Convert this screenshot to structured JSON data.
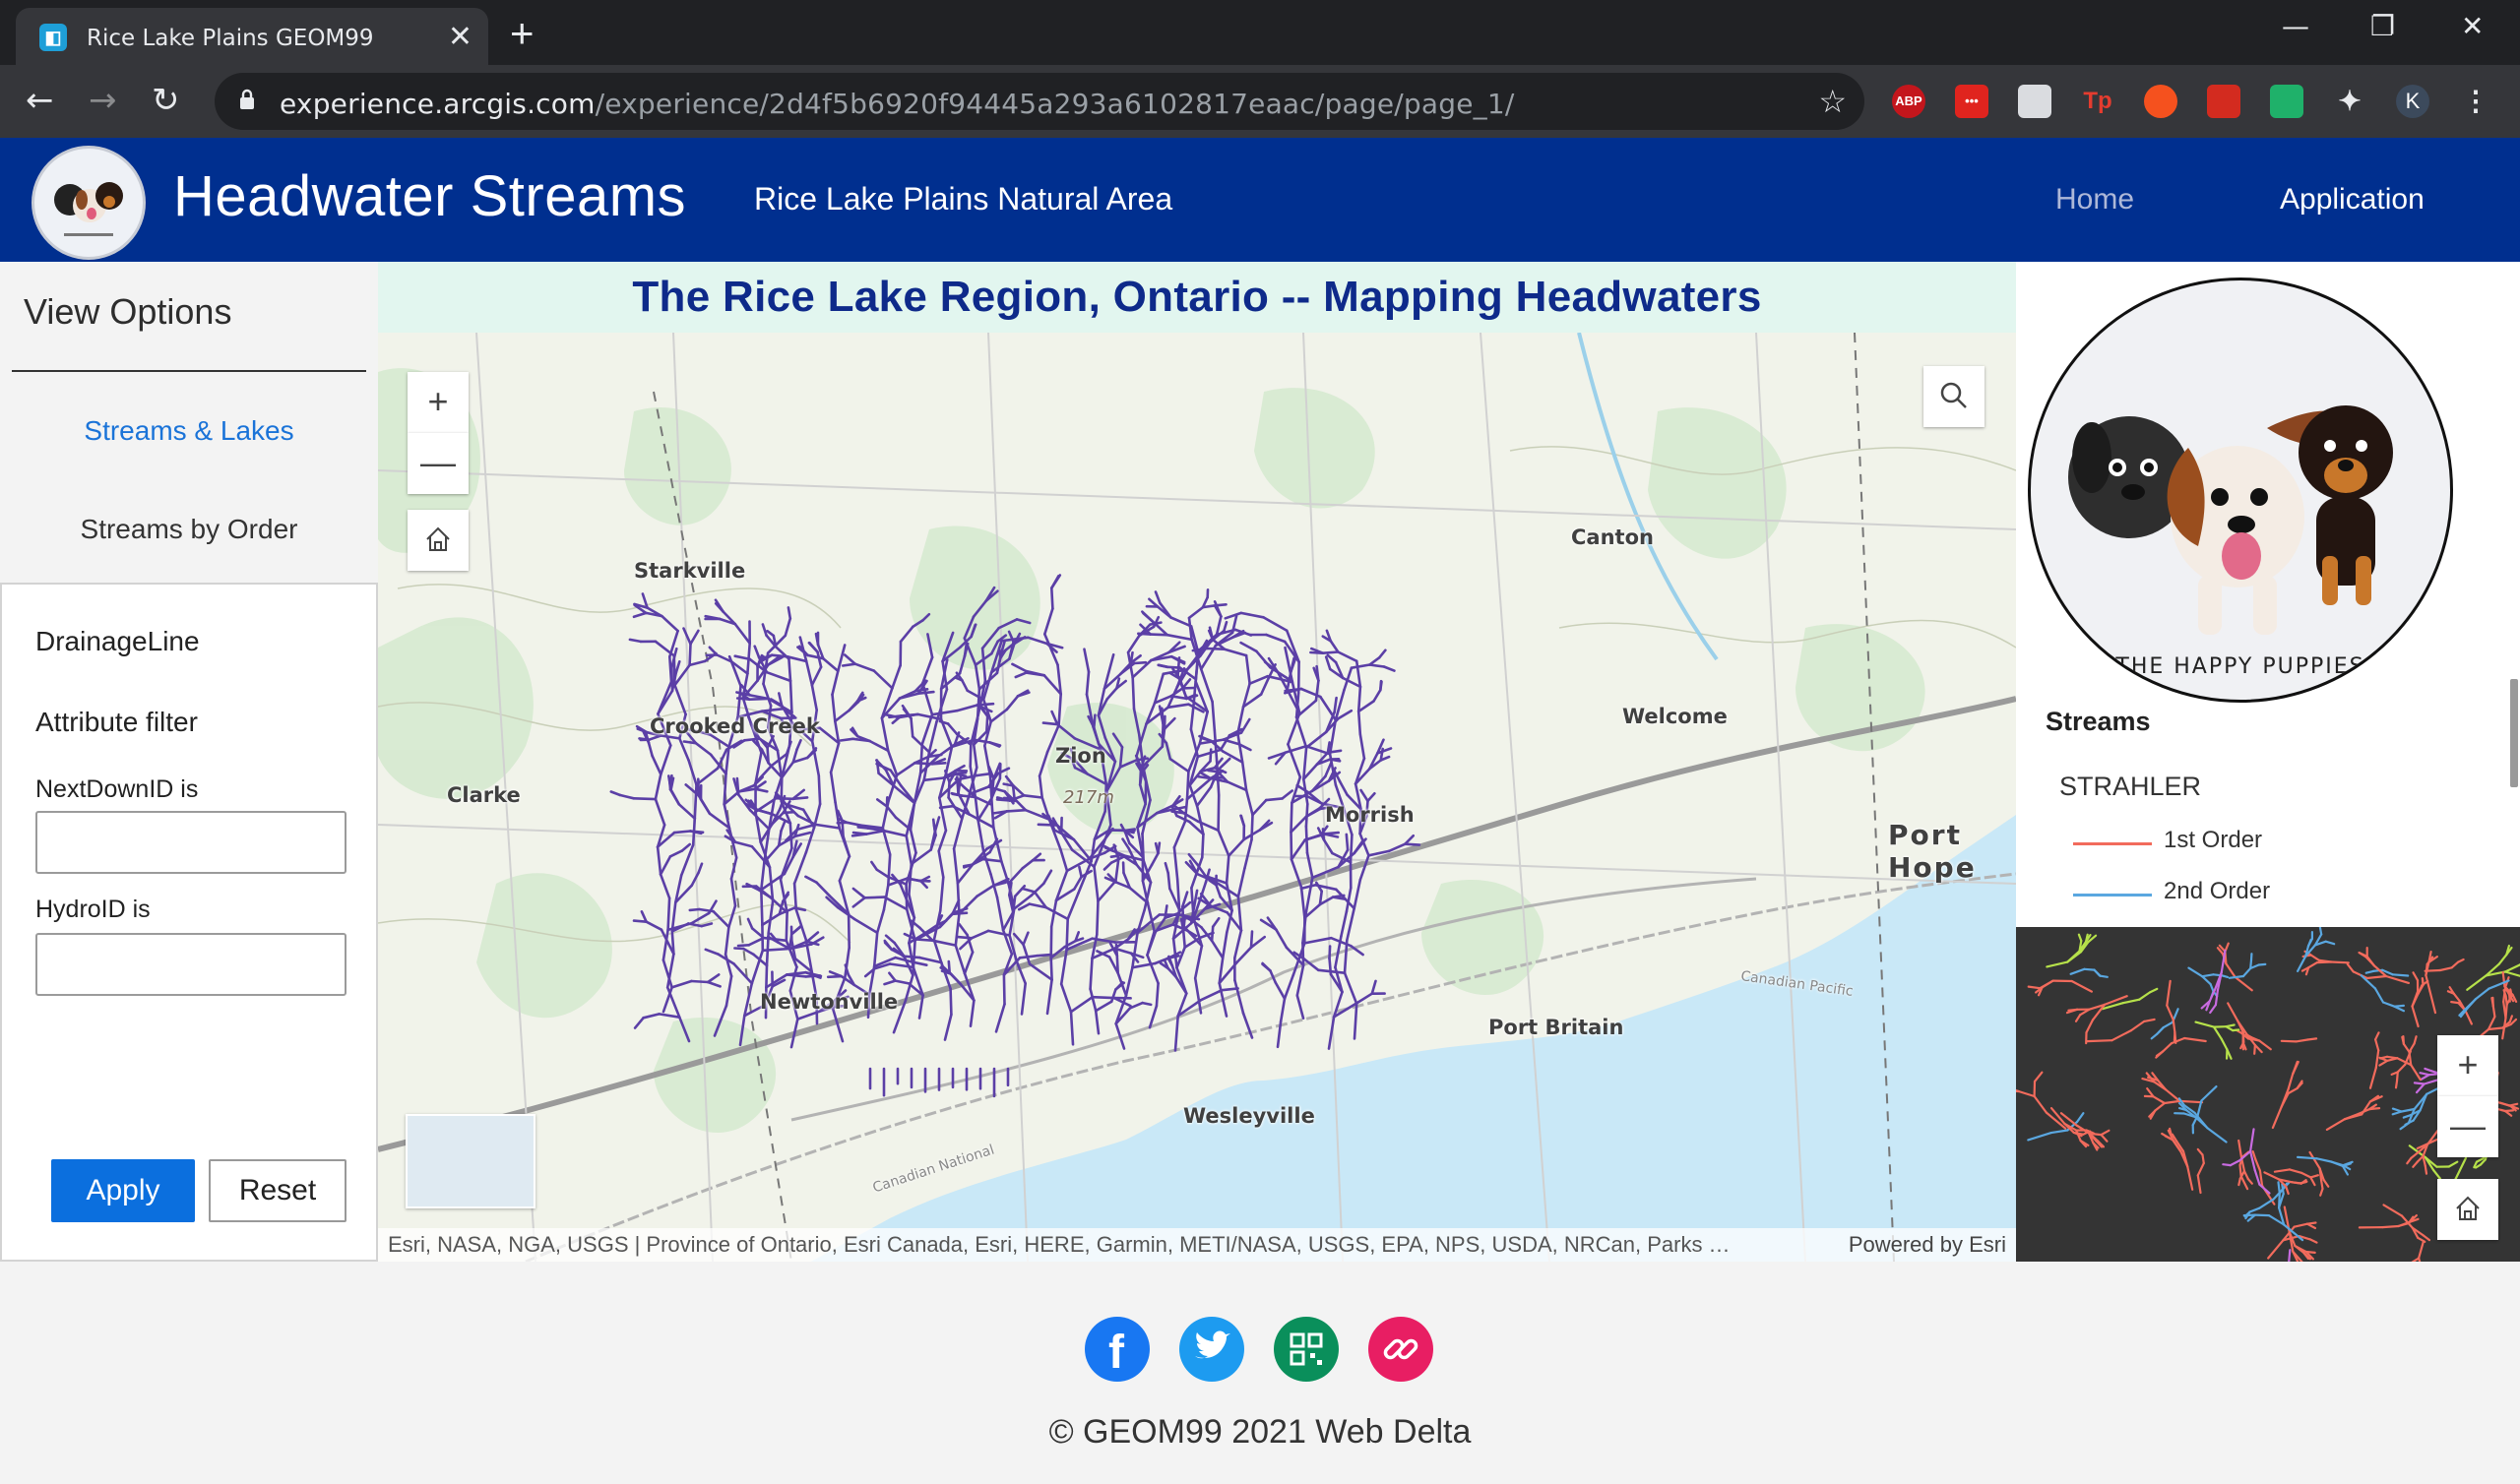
{
  "browser": {
    "tab_title": "Rice Lake Plains GEOM99",
    "tab_close": "✕",
    "new_tab": "+",
    "url_host": "experience.arcgis.com",
    "url_path": "/experience/2d4f5b6920f94445a293a6102817eaac/page/page_1/",
    "extensions": [
      "ABP",
      "•••",
      "",
      "Tp",
      "",
      "",
      "",
      "",
      "K"
    ]
  },
  "header": {
    "title": "Headwater Streams",
    "subtitle": "Rice Lake Plains Natural Area",
    "nav": {
      "home": "Home",
      "application": "Application"
    },
    "bg_color": "#002f8f"
  },
  "left_panel": {
    "heading": "View Options",
    "links": [
      "Streams & Lakes",
      "Streams by Order"
    ],
    "filter": {
      "layer": "DrainageLine",
      "section": "Attribute filter",
      "field1_label": "NextDownID is",
      "field1_value": "",
      "field2_label": "HydroID is",
      "field2_value": "",
      "apply": "Apply",
      "reset": "Reset"
    }
  },
  "map": {
    "banner": "The Rice Lake Region, Ontario --  Mapping Headwaters",
    "places": [
      "Starkville",
      "Crooked Creek",
      "Clarke",
      "Zion",
      "217m",
      "Morrish",
      "Canton",
      "Welcome",
      "Port Hope",
      "Newtonville",
      "Port Britain",
      "Wesleyville",
      "Canadian Pacific",
      "Canadian National"
    ],
    "attribution": "Esri, NASA, NGA, USGS | Province of Ontario, Esri Canada, Esri, HERE, Garmin, METI/NASA, USGS, EPA, NPS, USDA, NRCan, Parks …",
    "powered_by": "Powered by Esri",
    "stream_color": "#5b3fa6",
    "water_color": "#c9e8f7"
  },
  "right_panel": {
    "logo_text": "THE HAPPY PUPPIES",
    "legend_title": "Streams",
    "legend_field": "STRAHLER",
    "legend_items": [
      {
        "label": "1st Order",
        "color": "#f26b5c"
      },
      {
        "label": "2nd Order",
        "color": "#5aa7e0"
      }
    ]
  },
  "footer": {
    "copyright": "© GEOM99 2021 Web Delta",
    "social": [
      "facebook-icon",
      "twitter-icon",
      "qr-code-icon",
      "link-icon"
    ],
    "social_colors": [
      "#1877f2",
      "#1d9bf0",
      "#0a8f5b",
      "#e81e63"
    ]
  }
}
